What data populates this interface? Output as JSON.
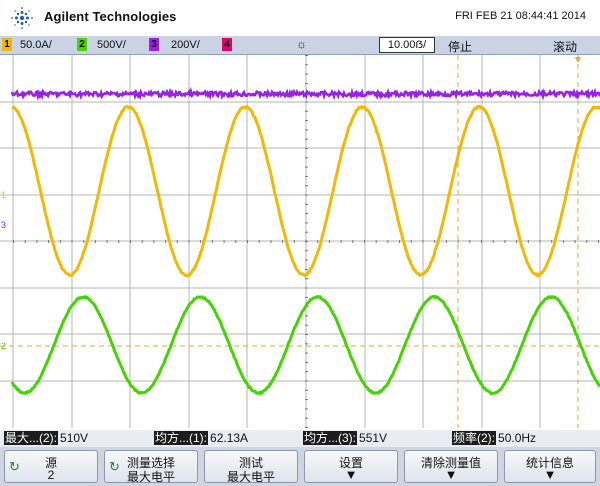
{
  "header": {
    "brand": "Agilent Technologies",
    "datetime": "FRI FEB 21 08:44:41 2014"
  },
  "channels": [
    {
      "num": "1",
      "scale": "50.0A/",
      "color": "#f3b800"
    },
    {
      "num": "2",
      "scale": "500V/",
      "color": "#44d400"
    },
    {
      "num": "3",
      "scale": "200V/",
      "color": "#9b1fe8"
    },
    {
      "num": "4",
      "scale": "",
      "color": "#e0006e"
    }
  ],
  "timebase": "10.00ẞ/",
  "run_status": "停止",
  "trigger_mode": "滚动",
  "markers": {
    "ch1": "1",
    "ch3": "3",
    "ch2": "2"
  },
  "measurements": [
    {
      "label": "最大...(2):",
      "value": "510V"
    },
    {
      "label": "均方...(1):",
      "value": "62.13A"
    },
    {
      "label": "均方...(3):",
      "value": "551V"
    },
    {
      "label": "频率(2):",
      "value": "50.0Hz"
    }
  ],
  "softkeys": [
    {
      "line1": "源",
      "line2": "2",
      "rotate": true
    },
    {
      "line1": "测量选择",
      "line2": "最大电平",
      "rotate": true
    },
    {
      "line1": "测试",
      "line2": "最大电平",
      "rotate": false
    },
    {
      "line1": "设置",
      "line2": "",
      "arrow": true
    },
    {
      "line1": "清除测量值",
      "line2": "",
      "arrow": true
    },
    {
      "line1": "统计信息",
      "line2": "",
      "arrow": true
    }
  ],
  "colors": {
    "ch1": "#f3b800",
    "ch2": "#44d400",
    "ch3": "#9b1fe8",
    "ch4": "#e0006e",
    "cursor": "#f2a13a"
  },
  "icons": {
    "logo": "agilent-spark-icon",
    "trigger": "trigger-sun-icon",
    "rotate": "rotate-knob-icon",
    "arrow": "arrow-down-icon"
  }
}
